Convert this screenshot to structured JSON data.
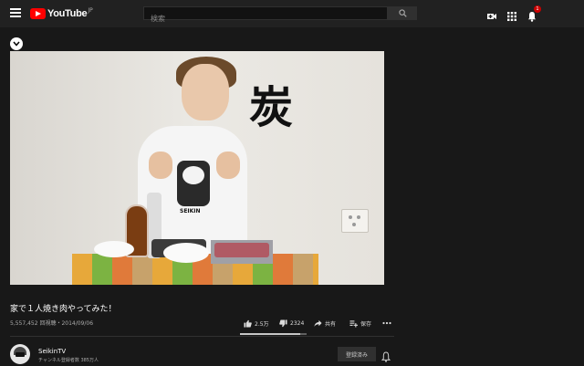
{
  "header": {
    "logo_text": "YouTube",
    "region": "JP",
    "search_placeholder": "検索",
    "notification_count": "1",
    "icons": [
      "menu-icon",
      "youtube-logo",
      "search-icon",
      "upload-icon",
      "apps-icon",
      "notifications-icon"
    ]
  },
  "player": {
    "overlay_text": "炭",
    "shirt_text": "SEIKIN"
  },
  "video": {
    "title": "家で１人焼き肉やってみた！",
    "views_date": "5,557,452 回視聴・2014/09/06",
    "like_count": "2.5万",
    "dislike_count": "2324",
    "share_label": "共有",
    "save_label": "保存",
    "like_ratio": 0.91
  },
  "channel": {
    "name": "SeikinTV",
    "subscribers": "チャンネル登録者数 385万人",
    "subscribe_label": "登録済み"
  },
  "colors": {
    "background": "#181818",
    "topbar": "#212121",
    "brand_red": "#ff0000"
  }
}
